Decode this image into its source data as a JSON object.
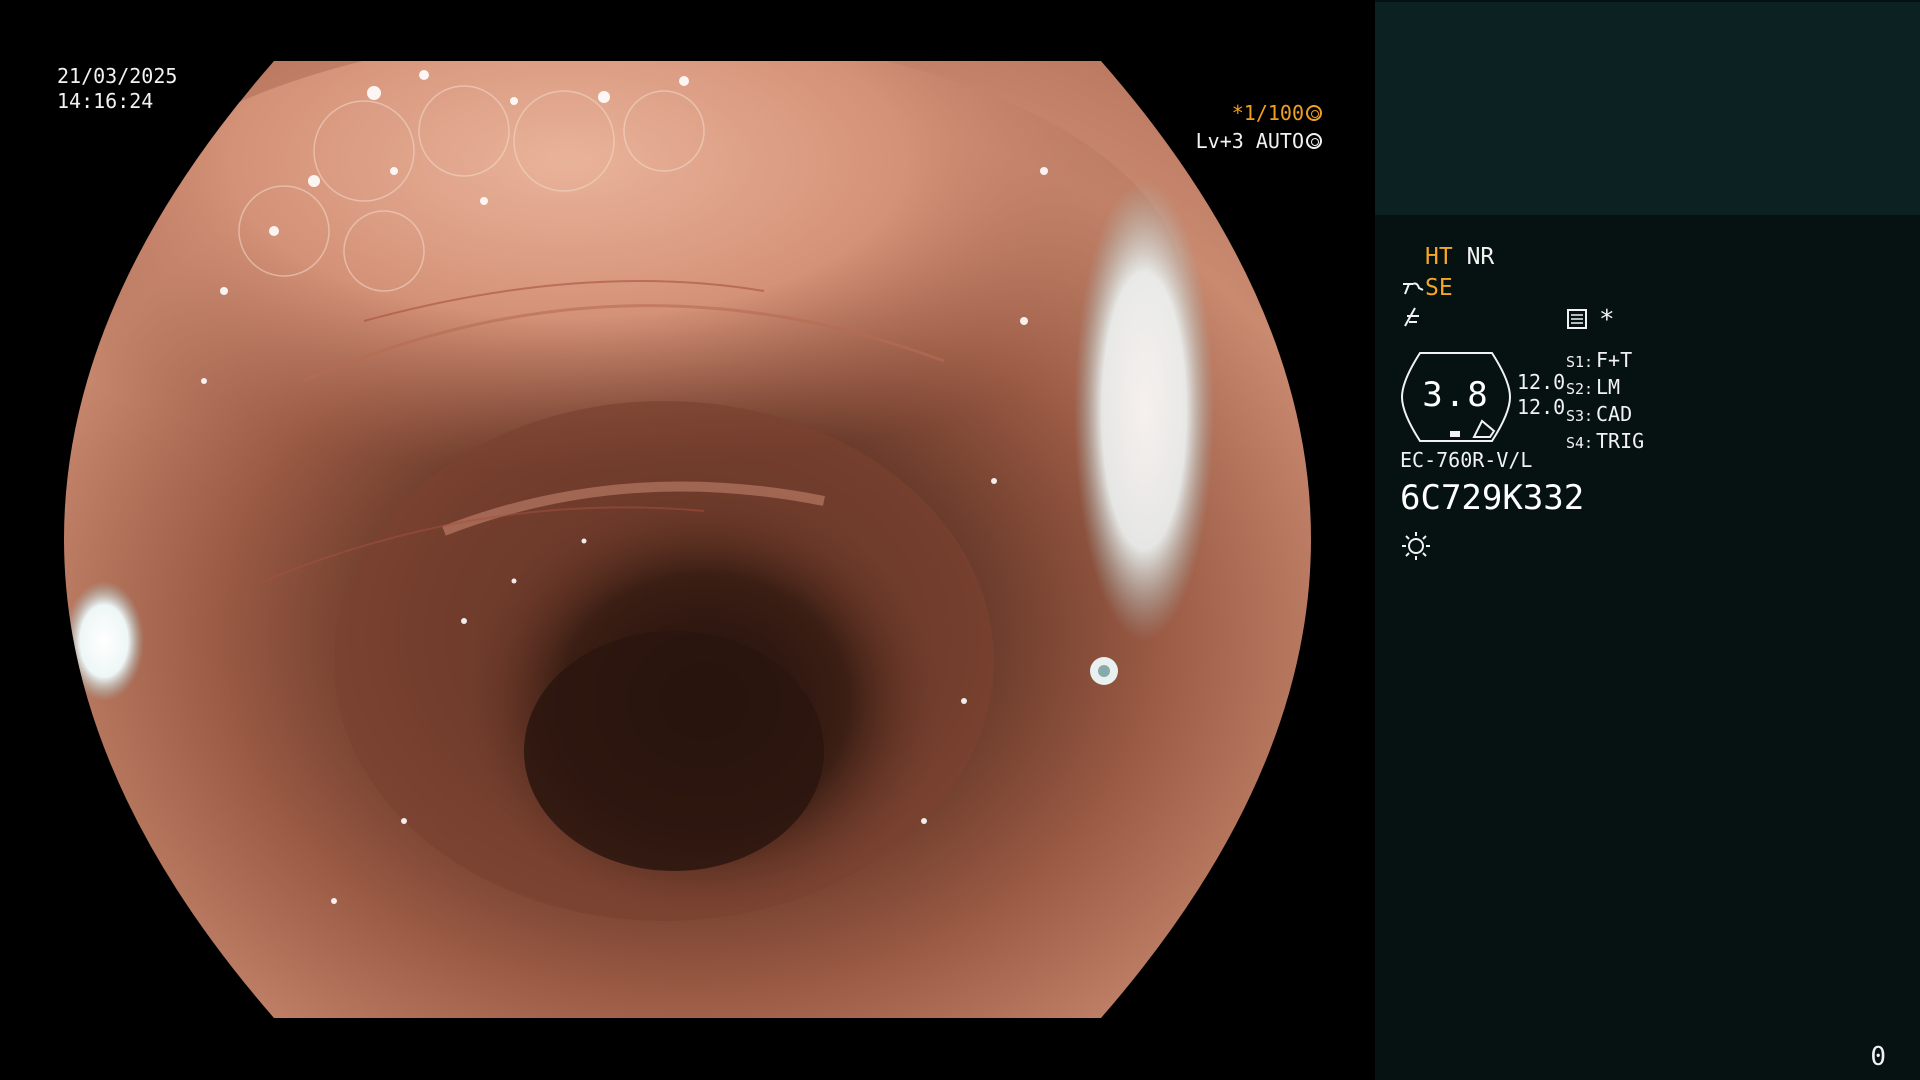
{
  "header": {
    "date": "21/03/2025",
    "time": "14:16:24"
  },
  "video": {
    "shutter_speed": "*1/100",
    "shutter_icon": "aperture-icon",
    "light_level": "Lv+3",
    "light_mode": "AUTO",
    "light_icon": "auto-iris-icon"
  },
  "side_panel": {
    "mode_ht": "HT",
    "mode_nr": "NR",
    "mode_se": "SE",
    "enhance_icon": "structure-enhance-icon",
    "contrast_icon": "contrast-icon",
    "record_icon": "record-memory-icon",
    "star_label": "*",
    "zoom_value": "3.8",
    "zoom_icon": "zoom-hex-icon",
    "value_top": "12.0",
    "value_bottom": "12.0",
    "settings": [
      {
        "key": "S1:",
        "value": "F+T"
      },
      {
        "key": "S2:",
        "value": "LM"
      },
      {
        "key": "S3:",
        "value": "CAD"
      },
      {
        "key": "S4:",
        "value": "TRIG"
      }
    ],
    "scope_model": "EC-760R-V/L",
    "scope_serial": "6C729K332",
    "light_source_icon": "sun-icon",
    "page_counter": "0"
  },
  "colors": {
    "panel_bg": "#051211",
    "thumb_bg": "#0c2222",
    "accent_orange": "#f5a623",
    "text_white": "#f2f2f2"
  }
}
